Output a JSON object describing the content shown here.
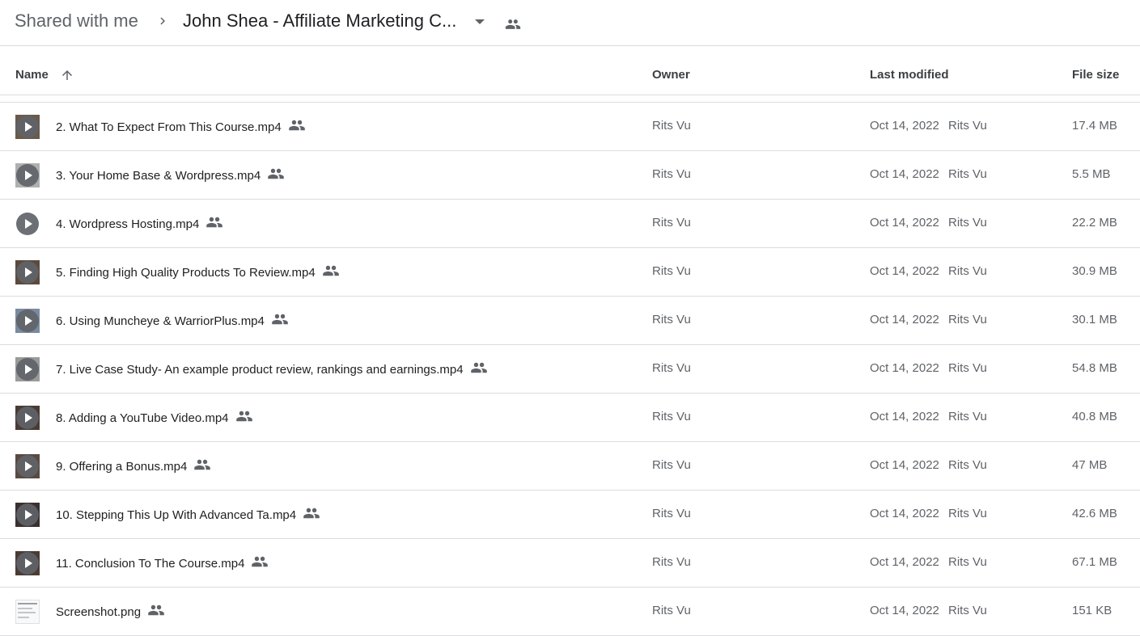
{
  "breadcrumb": {
    "root": "Shared with me",
    "current": "John Shea - Affiliate Marketing C..."
  },
  "columns": {
    "name": "Name",
    "owner": "Owner",
    "last_modified": "Last modified",
    "file_size": "File size"
  },
  "icons": {
    "separator": "chevron-right-icon",
    "caret": "caret-down-icon",
    "shared": "people-icon",
    "sort": "arrow-up-icon",
    "video": "play-icon",
    "image": "image-thumbnail-icon"
  },
  "colors": {
    "text_primary": "#202124",
    "text_secondary": "#5f6368",
    "divider": "#dadce0",
    "icon": "#5f6368"
  },
  "files": [
    {
      "name": "2. What To Expect From This Course.mp4",
      "owner": "Rits Vu",
      "modified": "Oct 14, 2022",
      "modified_by": "Rits Vu",
      "size": "17.4 MB",
      "type": "video",
      "thumb_bg": "#6b5a4a"
    },
    {
      "name": "3. Your Home Base & Wordpress.mp4",
      "owner": "Rits Vu",
      "modified": "Oct 14, 2022",
      "modified_by": "Rits Vu",
      "size": "5.5 MB",
      "type": "video",
      "thumb_bg": "#b0b0b0"
    },
    {
      "name": "4. Wordpress Hosting.mp4",
      "owner": "Rits Vu",
      "modified": "Oct 14, 2022",
      "modified_by": "Rits Vu",
      "size": "22.2 MB",
      "type": "video",
      "thumb_bg": "#ffffff"
    },
    {
      "name": "5. Finding High Quality Products To Review.mp4",
      "owner": "Rits Vu",
      "modified": "Oct 14, 2022",
      "modified_by": "Rits Vu",
      "size": "30.9 MB",
      "type": "video",
      "thumb_bg": "#5c4a3c"
    },
    {
      "name": "6. Using Muncheye & WarriorPlus.mp4",
      "owner": "Rits Vu",
      "modified": "Oct 14, 2022",
      "modified_by": "Rits Vu",
      "size": "30.1 MB",
      "type": "video",
      "thumb_bg": "#7a8aa0"
    },
    {
      "name": "7. Live Case Study- An example product review, rankings and earnings.mp4",
      "owner": "Rits Vu",
      "modified": "Oct 14, 2022",
      "modified_by": "Rits Vu",
      "size": "54.8 MB",
      "type": "video",
      "thumb_bg": "#9a9a9a"
    },
    {
      "name": "8. Adding a YouTube Video.mp4",
      "owner": "Rits Vu",
      "modified": "Oct 14, 2022",
      "modified_by": "Rits Vu",
      "size": "40.8 MB",
      "type": "video",
      "thumb_bg": "#4a3c34"
    },
    {
      "name": "9. Offering a Bonus.mp4",
      "owner": "Rits Vu",
      "modified": "Oct 14, 2022",
      "modified_by": "Rits Vu",
      "size": "47 MB",
      "type": "video",
      "thumb_bg": "#5a4a40"
    },
    {
      "name": "10. Stepping This Up With Advanced Ta.mp4",
      "owner": "Rits Vu",
      "modified": "Oct 14, 2022",
      "modified_by": "Rits Vu",
      "size": "42.6 MB",
      "type": "video",
      "thumb_bg": "#3a3030"
    },
    {
      "name": "11. Conclusion To The Course.mp4",
      "owner": "Rits Vu",
      "modified": "Oct 14, 2022",
      "modified_by": "Rits Vu",
      "size": "67.1 MB",
      "type": "video",
      "thumb_bg": "#4a3c34"
    },
    {
      "name": "Screenshot.png",
      "owner": "Rits Vu",
      "modified": "Oct 14, 2022",
      "modified_by": "Rits Vu",
      "size": "151 KB",
      "type": "image",
      "thumb_bg": "#f8f9fa"
    }
  ]
}
